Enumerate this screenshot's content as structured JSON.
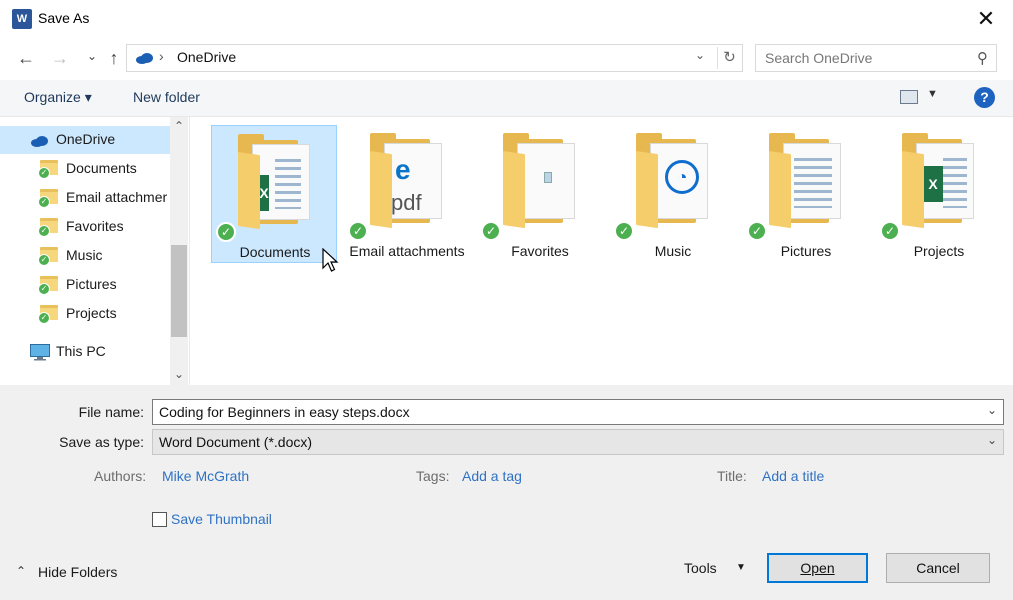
{
  "window": {
    "title": "Save As",
    "app_icon": "W",
    "close_glyph": "✕"
  },
  "nav": {
    "back_glyph": "←",
    "forward_glyph": "→",
    "recent_glyph": "⌄",
    "up_glyph": "↑",
    "address_sep": "›",
    "address": "OneDrive",
    "address_drop": "⌄",
    "refresh_glyph": "↻",
    "search_placeholder": "Search OneDrive",
    "search_glyph": "⚲"
  },
  "toolbar": {
    "organize": "Organize ▾",
    "new_folder": "New folder",
    "view_drop": "▼",
    "help": "?"
  },
  "sidebar": {
    "scroll_up": "⌃",
    "scroll_down": "⌄",
    "items": [
      {
        "label": "OneDrive"
      },
      {
        "label": "Documents"
      },
      {
        "label": "Email attachmer"
      },
      {
        "label": "Favorites"
      },
      {
        "label": "Music"
      },
      {
        "label": "Pictures"
      },
      {
        "label": "Projects"
      },
      {
        "label": "This PC"
      }
    ]
  },
  "files": [
    {
      "label": "Documents",
      "glyph": "X"
    },
    {
      "label": "Email attachments",
      "glyph": "e",
      "glyph2": "pdf"
    },
    {
      "label": "Favorites",
      "glyph": ""
    },
    {
      "label": "Music",
      "glyph": "◔"
    },
    {
      "label": "Pictures",
      "glyph": ""
    },
    {
      "label": "Projects",
      "glyph": "X"
    }
  ],
  "check_glyph": "✓",
  "form": {
    "file_name_label": "File name:",
    "file_name_value": "Coding for Beginners in easy steps.docx",
    "save_type_label": "Save as type:",
    "save_type_value": "Word Document (*.docx)",
    "drop_glyph": "⌄",
    "authors_label": "Authors:",
    "authors_value": "Mike McGrath",
    "tags_label": "Tags:",
    "tags_value": "Add a tag",
    "title_label": "Title:",
    "title_value": "Add a title",
    "thumbnail_label": "Save Thumbnail"
  },
  "footer": {
    "hide_folders": "Hide Folders",
    "hide_glyph": "⌃",
    "tools": "Tools",
    "tools_drop": "▼",
    "open": "Open",
    "cancel": "Cancel"
  },
  "colors": {
    "accent": "#0078d7",
    "link": "#2f72c4",
    "selection": "#cce8ff",
    "check": "#4caf50"
  }
}
